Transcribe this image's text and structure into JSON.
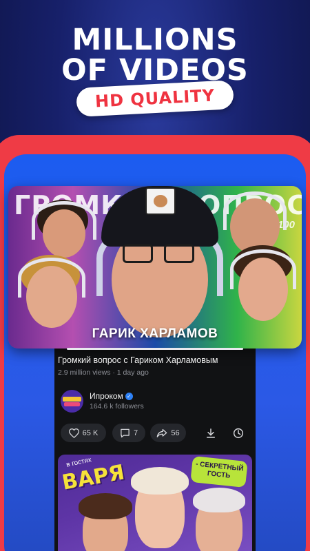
{
  "promo": {
    "headline_line1": "MILLIONS",
    "headline_line2": "OF VIDEOS",
    "badge": "HD QUALITY"
  },
  "colors": {
    "background": "#17206a",
    "frame_red": "#ef3b45",
    "frame_blue": "#1c5cf0",
    "badge_text": "#ef3340",
    "verified": "#2d81f7"
  },
  "hero_video": {
    "thumbnail_title": "ГРОМКИЙ ВОПРОС",
    "thumbnail_episode": "#100",
    "thumbnail_guest_name": "ГАРИК ХАРЛАМОВ",
    "title": "Громкий вопрос с Гариком Харламовым",
    "meta": "2.9 million views · 1 day ago",
    "channel": {
      "name": "Ипроком",
      "followers": "164.6 k followers",
      "verified": true
    },
    "actions": {
      "likes": "65 K",
      "comments": "7",
      "shares": "56"
    },
    "icons": [
      "heart-icon",
      "comment-icon",
      "share-icon",
      "download-icon",
      "clock-icon"
    ]
  },
  "next_video": {
    "thumbnail_guest_label": "в гостях",
    "thumbnail_word": "ВАРЯ",
    "thumbnail_badge": "- СЕКРЕТНЫЙ ГОСТЬ"
  }
}
